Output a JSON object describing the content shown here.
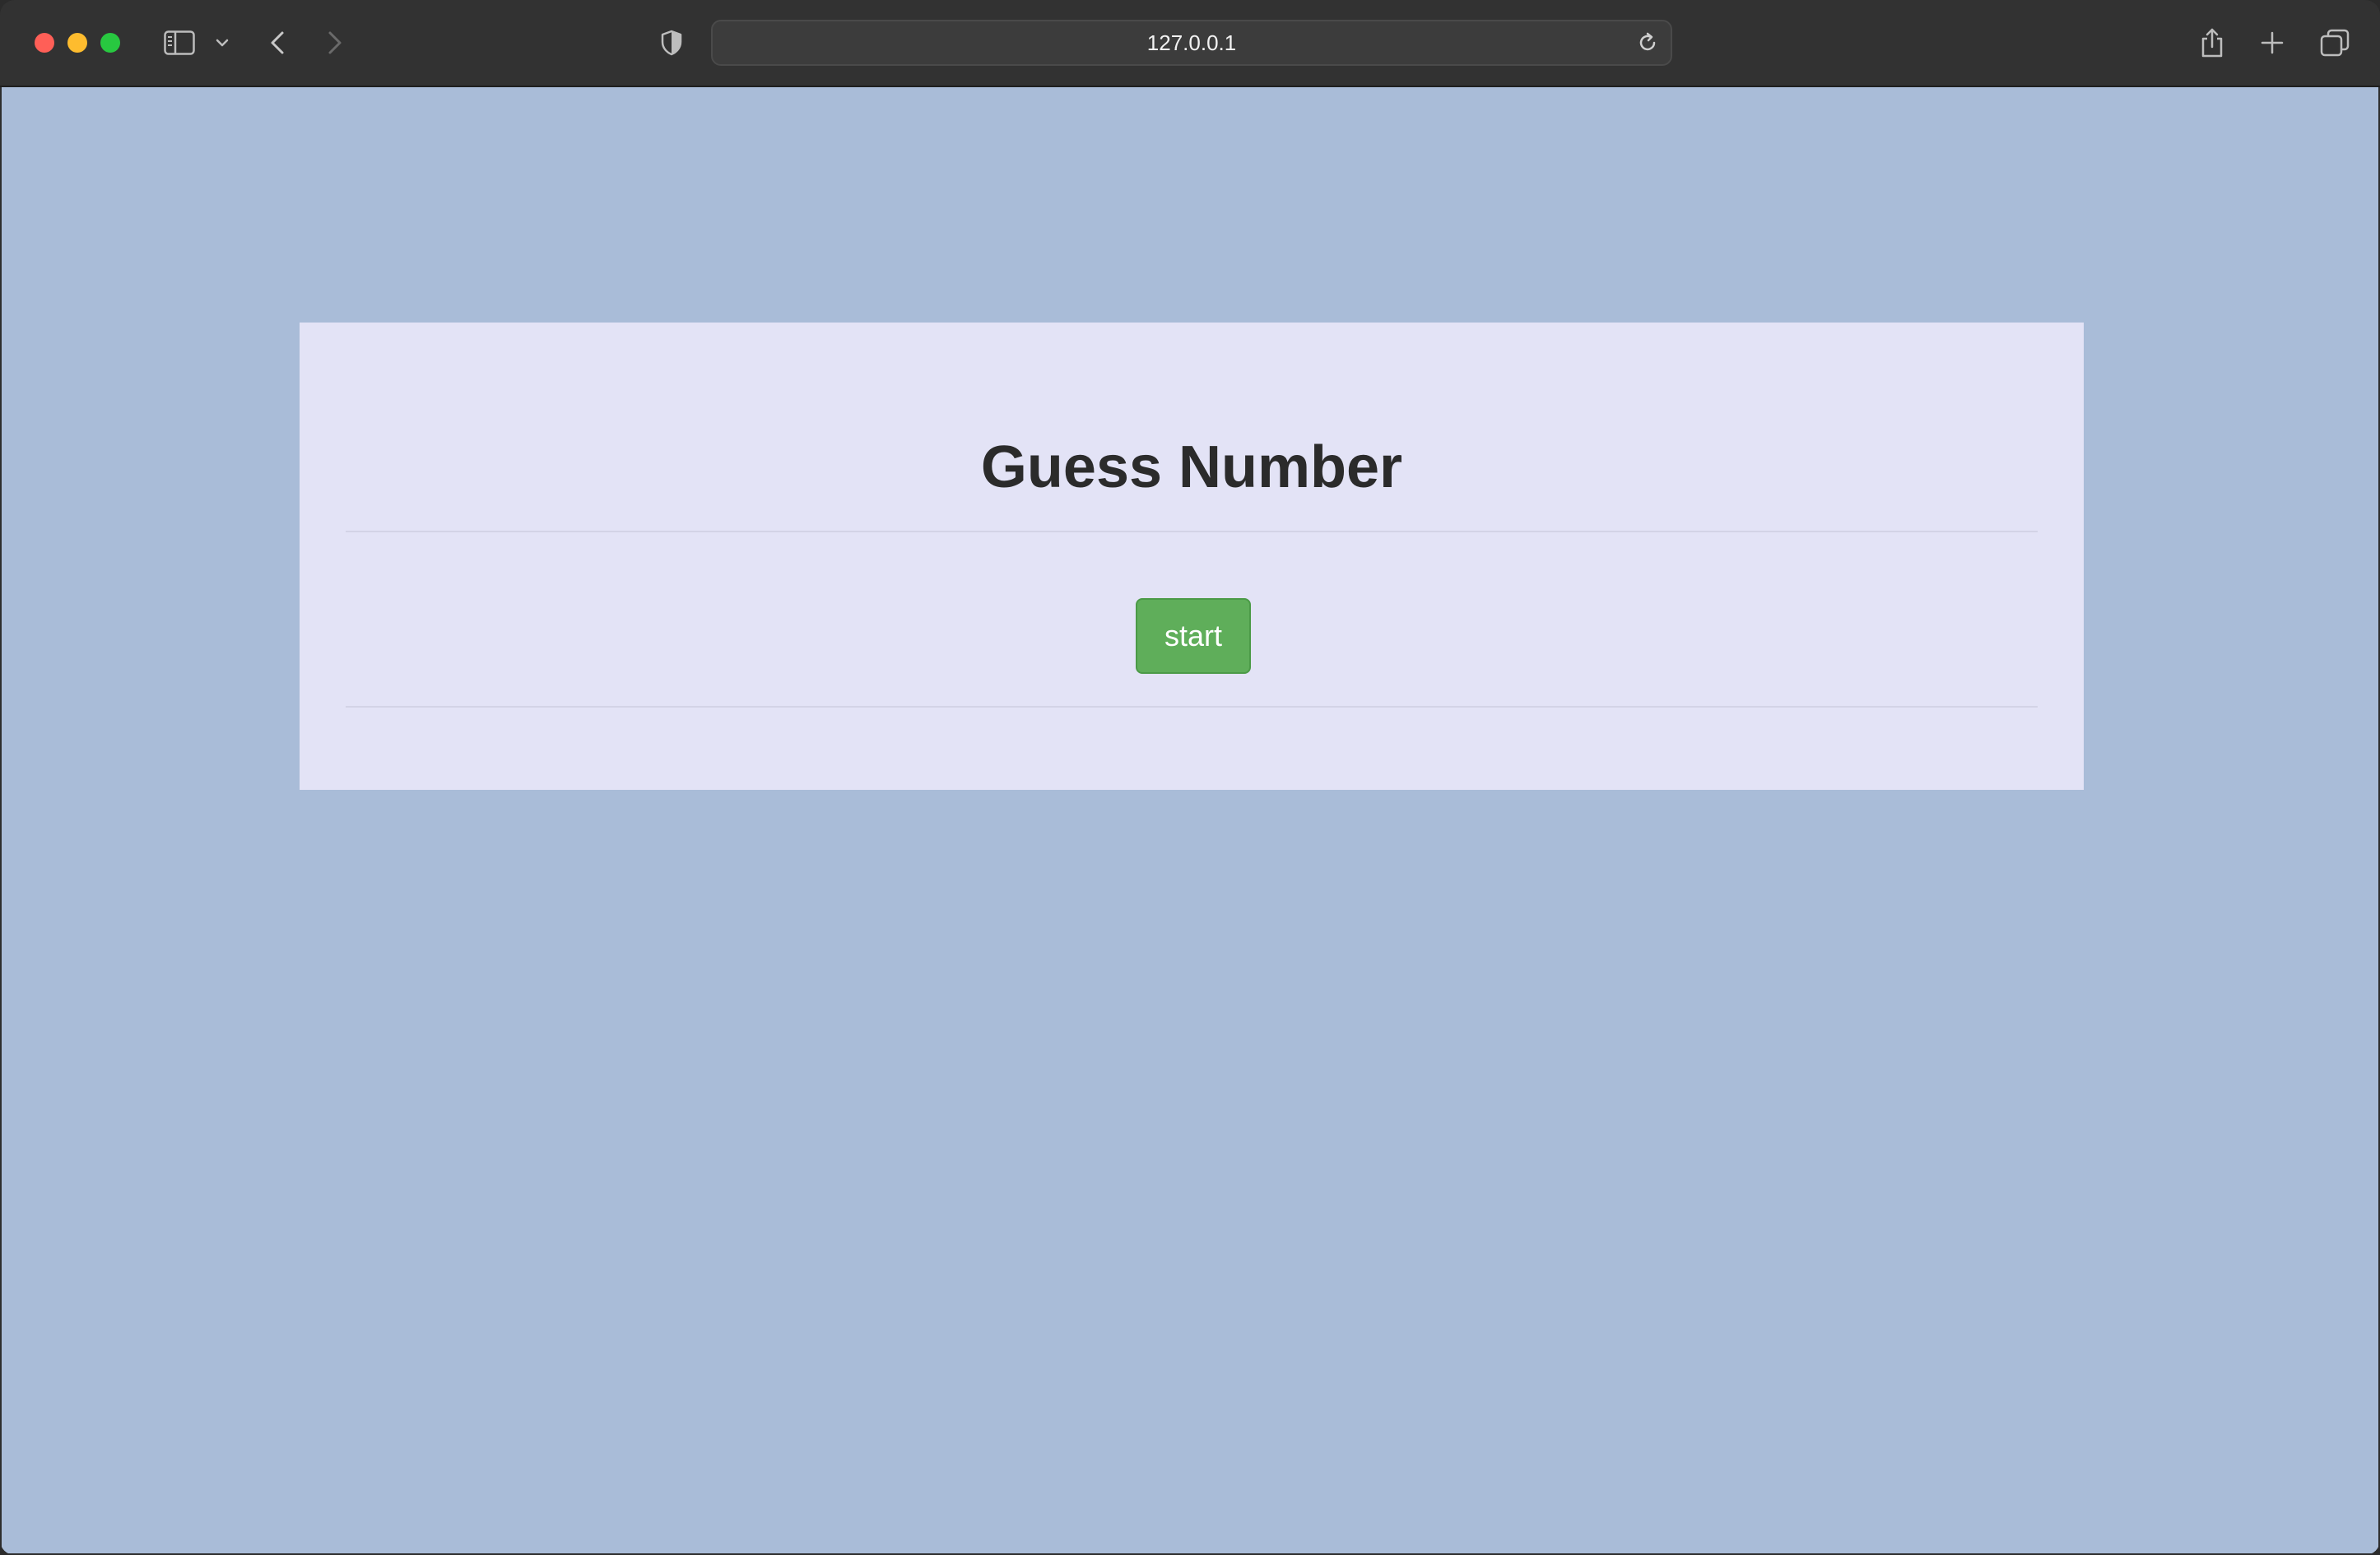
{
  "browser": {
    "address": "127.0.0.1",
    "icons": {
      "sidebar": "sidebar-icon",
      "sidebar_menu": "chevron-down-icon",
      "back": "chevron-left-icon",
      "forward": "chevron-right-icon",
      "privacy": "shield-icon",
      "reload": "reload-icon",
      "share": "share-icon",
      "new_tab": "plus-icon",
      "tabs": "tabs-overview-icon"
    },
    "colors": {
      "close": "#ff5f57",
      "minimize": "#febc2e",
      "zoom": "#28c840"
    }
  },
  "page": {
    "background": "#a9bcd8",
    "card_background": "#e3e3f6",
    "title": "Guess Number",
    "start_label": "start",
    "start_color": "#5fae5a"
  }
}
